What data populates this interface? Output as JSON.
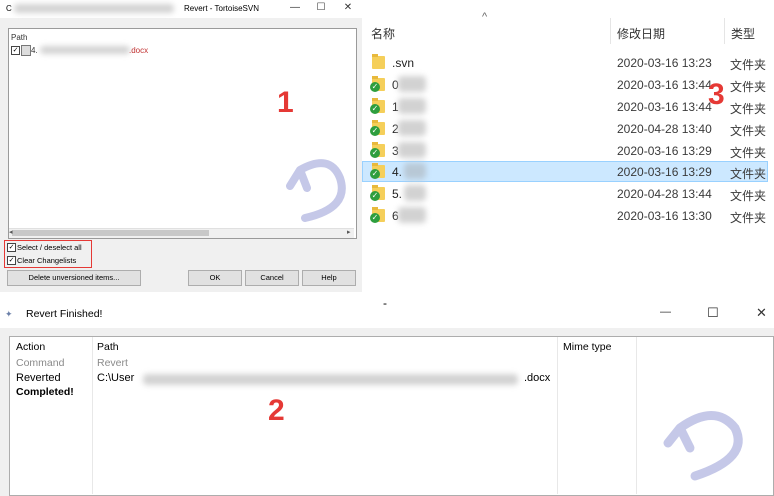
{
  "revert_dialog": {
    "title_prefix": "C",
    "title_suffix": "Revert - TortoiseSVN",
    "win_controls": {
      "minimize": "—",
      "maximize": "☐",
      "close": "✕"
    },
    "column_path": "Path",
    "file_item": {
      "prefix": "4.",
      "suffix": ".docx",
      "checked": true
    },
    "select_all_label": "Select / deselect all",
    "clear_changelists_label": "Clear Changelists",
    "buttons": {
      "delete_unversioned": "Delete unversioned items...",
      "ok": "OK",
      "cancel": "Cancel",
      "help": "Help"
    }
  },
  "explorer": {
    "columns": {
      "name": "名称",
      "modified": "修改日期",
      "type": "类型"
    },
    "rows": [
      {
        "name": ".svn",
        "date": "2020-03-16 13:23",
        "type": "文件夹",
        "svn_ok": false,
        "selected": false
      },
      {
        "name": "0",
        "date": "2020-03-16 13:44",
        "type": "文件夹",
        "svn_ok": true,
        "selected": false
      },
      {
        "name": "1",
        "date": "2020-03-16 13:44",
        "type": "文件夹",
        "svn_ok": true,
        "selected": false
      },
      {
        "name": "2",
        "date": "2020-04-28 13:40",
        "type": "文件夹",
        "svn_ok": true,
        "selected": false
      },
      {
        "name": "3",
        "date": "2020-03-16 13:29",
        "type": "文件夹",
        "svn_ok": true,
        "selected": false
      },
      {
        "name": "4.",
        "date": "2020-03-16 13:29",
        "type": "文件夹",
        "svn_ok": true,
        "selected": true
      },
      {
        "name": "5.",
        "date": "2020-04-28 13:44",
        "type": "文件夹",
        "svn_ok": true,
        "selected": false
      },
      {
        "name": "6",
        "date": "2020-03-16 13:30",
        "type": "文件夹",
        "svn_ok": true,
        "selected": false
      }
    ]
  },
  "finished_dialog": {
    "title": "Revert Finished!",
    "win_controls": {
      "minimize": "—",
      "maximize": "☐",
      "close": "✕"
    },
    "columns": {
      "action": "Action",
      "path": "Path",
      "mime": "Mime type"
    },
    "rows": [
      {
        "action": "Command",
        "path": "Revert",
        "style": "grey"
      },
      {
        "action": "Reverted",
        "path_prefix": "C:\\User",
        "path_suffix": ".docx",
        "style": "normal"
      },
      {
        "action": "Completed!",
        "path": "",
        "style": "bold"
      }
    ]
  },
  "annotations": [
    "1",
    "2",
    "3"
  ],
  "colors": {
    "annotation_red": "#e53935",
    "selection_blue": "#cce8ff",
    "svn_green": "#2e9e3e"
  }
}
